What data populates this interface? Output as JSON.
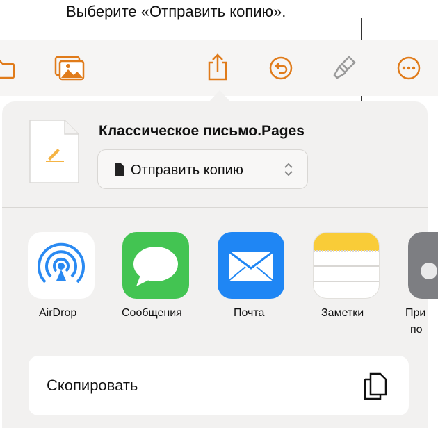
{
  "callout": {
    "text": "Выберите «Отправить копию»."
  },
  "toolbar": {
    "icons": [
      "folder-icon",
      "media-icon",
      "share-icon",
      "undo-icon",
      "format-brush-icon",
      "more-icon"
    ],
    "accent_color": "#e07b1a"
  },
  "document": {
    "title": "Классическое письмо.Pages",
    "send_option": "Отправить копию"
  },
  "apps": [
    {
      "label": "AirDrop"
    },
    {
      "label": "Сообщения"
    },
    {
      "label": "Почта"
    },
    {
      "label": "Заметки"
    },
    {
      "label_line1": "При",
      "label_line2": "по"
    }
  ],
  "actions": {
    "copy_label": "Скопировать"
  }
}
